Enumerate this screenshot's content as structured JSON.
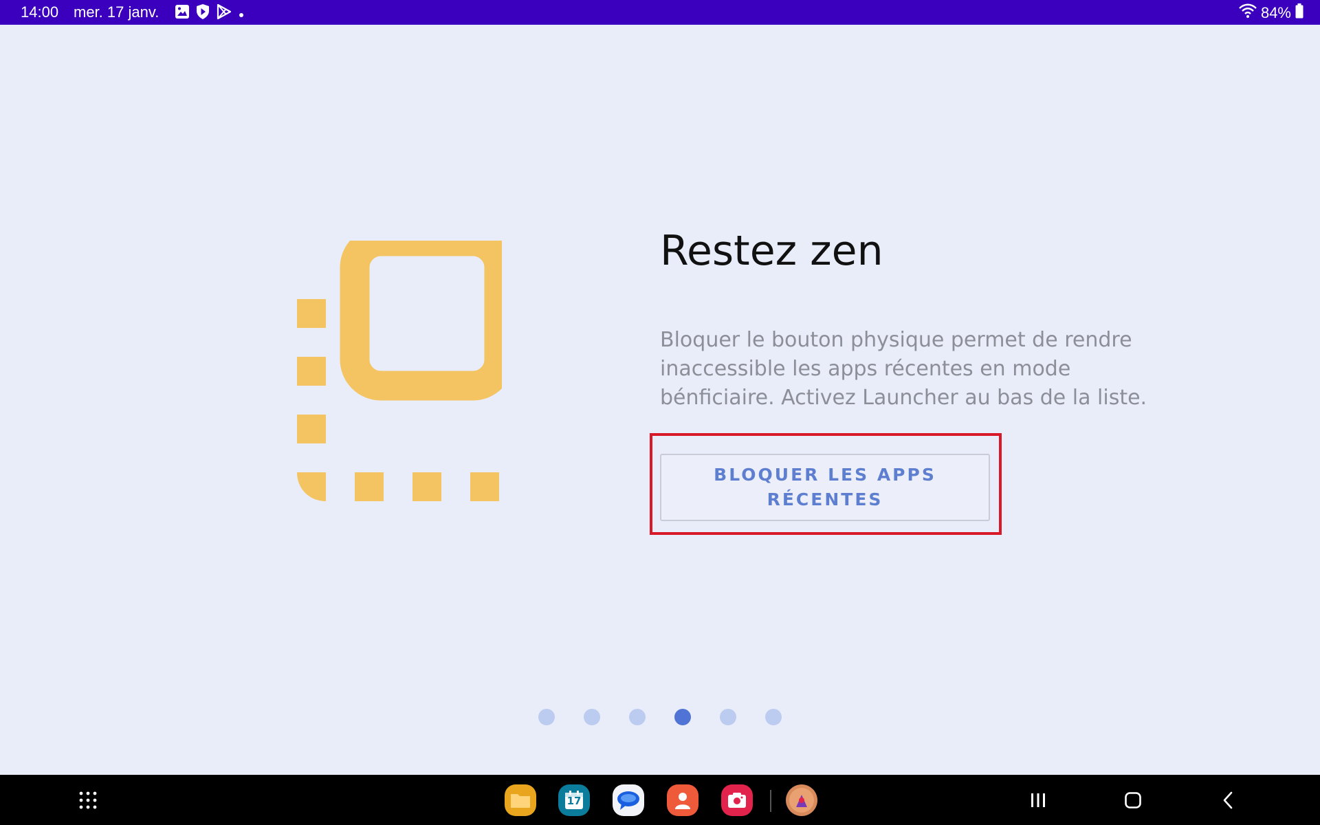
{
  "status_bar": {
    "time": "14:00",
    "date": "mer. 17 janv.",
    "notification_icons": [
      "gallery-icon",
      "shield-play-icon",
      "play-store-icon",
      "more-dot-icon"
    ],
    "wifi_icon": "wifi-icon",
    "battery": "84%",
    "battery_icon": "battery-icon"
  },
  "slide": {
    "title": "Restez zen",
    "description": "Bloquer le bouton physique permet de rendre inaccessible les apps récentes en mode bénficiaire. Activez Launcher au bas de la liste.",
    "button_label": "BLOQUER LES APPS RÉCENTES",
    "illustration_icon": "recent-apps-icon",
    "accent_color": "#f4c462",
    "highlight_color": "#d9182a"
  },
  "pager": {
    "total": 6,
    "active_index": 4
  },
  "navbar": {
    "apps_drawer_icon": "app-drawer-icon",
    "dock_apps": [
      "files-app-icon",
      "calendar-app-icon",
      "messages-app-icon",
      "contacts-app-icon",
      "screen-recorder-app-icon",
      "launcher-app-icon"
    ],
    "calendar_day": "17",
    "recents_icon": "recents-icon",
    "home_icon": "home-icon",
    "back_icon": "back-icon"
  }
}
